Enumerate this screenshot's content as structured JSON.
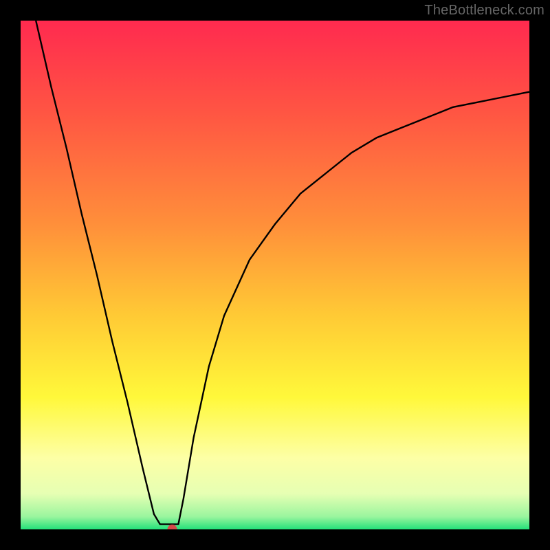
{
  "watermark": "TheBottleneck.com",
  "chart_data": {
    "type": "line",
    "title": "",
    "xlabel": "",
    "ylabel": "",
    "xlim": [
      0,
      1
    ],
    "ylim": [
      0,
      1
    ],
    "background_gradient_stops": [
      {
        "pos": 0.0,
        "color": "#ff2a4f"
      },
      {
        "pos": 0.18,
        "color": "#ff5543"
      },
      {
        "pos": 0.4,
        "color": "#ff8f3a"
      },
      {
        "pos": 0.58,
        "color": "#ffca35"
      },
      {
        "pos": 0.74,
        "color": "#fff83a"
      },
      {
        "pos": 0.86,
        "color": "#fdffa6"
      },
      {
        "pos": 0.93,
        "color": "#e6ffb3"
      },
      {
        "pos": 0.975,
        "color": "#9af59e"
      },
      {
        "pos": 1.0,
        "color": "#23e07a"
      }
    ],
    "series": [
      {
        "name": "bottleneck-curve",
        "color": "#000000",
        "x": [
          0.03,
          0.06,
          0.09,
          0.12,
          0.15,
          0.18,
          0.21,
          0.24,
          0.262,
          0.274,
          0.286,
          0.298,
          0.31,
          0.32,
          0.34,
          0.37,
          0.4,
          0.45,
          0.5,
          0.55,
          0.6,
          0.65,
          0.7,
          0.75,
          0.8,
          0.85,
          0.9,
          0.95,
          1.0
        ],
        "y": [
          1.0,
          0.87,
          0.75,
          0.62,
          0.5,
          0.37,
          0.25,
          0.12,
          0.03,
          0.01,
          0.01,
          0.01,
          0.01,
          0.06,
          0.18,
          0.32,
          0.42,
          0.53,
          0.6,
          0.66,
          0.7,
          0.74,
          0.77,
          0.79,
          0.81,
          0.83,
          0.84,
          0.85,
          0.86
        ]
      }
    ],
    "marker": {
      "x": 0.298,
      "y": 0.0,
      "color": "#d54a49",
      "r": 7
    },
    "flat_floor": {
      "x0": 0.262,
      "x1": 0.31,
      "y": 0.01
    }
  }
}
